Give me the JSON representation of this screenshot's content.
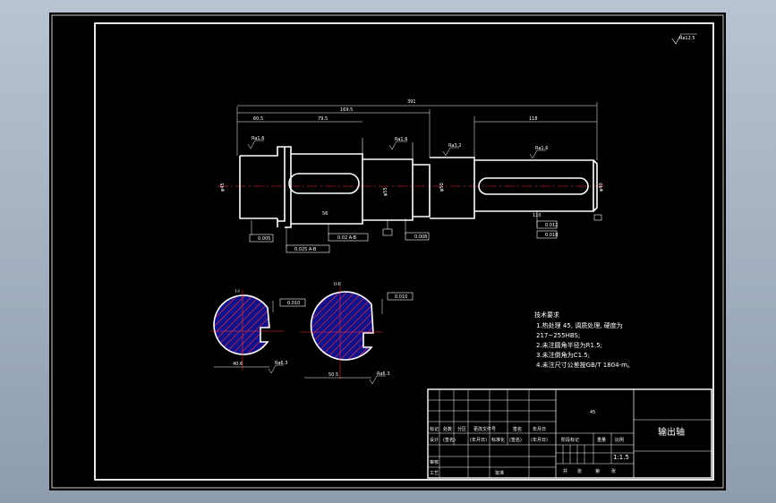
{
  "drawing": {
    "roughness_note": "Ra12.5",
    "dims": {
      "overall": "391",
      "span_a": "169.5",
      "span_b": "60.5",
      "span_c": "79.5",
      "span_d": "118",
      "dia_left": "φ45",
      "dia_mid": "φ55",
      "dia_mid2": "φ50",
      "dia_right": "φ40",
      "tol_a": "0.005",
      "tol_b": "0.025  A-B",
      "tol_c": "0.02  A-B",
      "tol_d": "0.008",
      "tol_e": "0.012",
      "tol_f": "0.018",
      "key_len_a": "56",
      "key_len_b": "110",
      "rough_a": "Ra1.6",
      "rough_b": "Ra3.2"
    },
    "section_a": {
      "label": "I-I",
      "tol": "0.010",
      "dim": "40.6",
      "rough": "Ra6.3"
    },
    "section_b": {
      "label": "II-II",
      "tol": "0.010",
      "dim": "50.5",
      "rough": "Ra6.3"
    }
  },
  "tech_notes": {
    "title": "技术要求",
    "lines": [
      "1.热处理 45, 调质处理, 硬度为",
      "217~255HBS;",
      "2.未注圆角半径为R1.5;",
      "3.未注倒角为C1.5;",
      "4.未注尺寸公差按GB/T 1804-m。"
    ]
  },
  "title_block": {
    "part_name": "输出轴",
    "material": "45",
    "scale": "1:1.5",
    "row1": [
      "标记",
      "处数",
      "分区",
      "更改文件号",
      "签名",
      "年月日"
    ],
    "row2": [
      "设计",
      "(签名)",
      "(年月日)",
      "标准化",
      "(签名)",
      "(年月日)"
    ],
    "row3_label": "审核",
    "row4_label": "工艺",
    "row4_mid": "批准",
    "stage_headers": [
      "阶段标记",
      "重量",
      "比例"
    ],
    "sheet_row": [
      "共",
      "张",
      "第",
      "张"
    ]
  }
}
